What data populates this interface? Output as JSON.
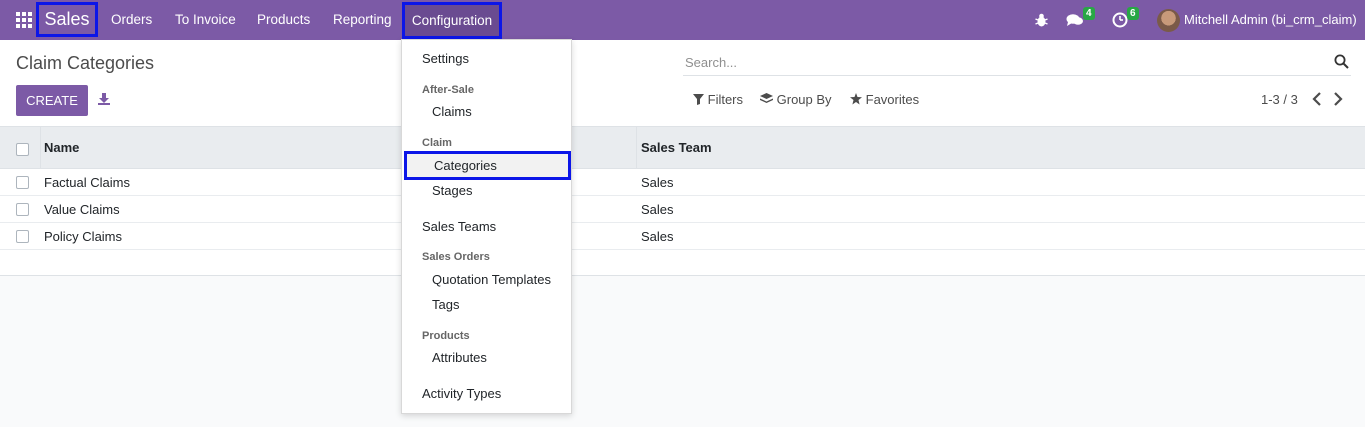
{
  "navbar": {
    "app_name": "Sales",
    "menu": [
      "Orders",
      "To Invoice",
      "Products",
      "Reporting"
    ],
    "active_menu": "Configuration",
    "messages_count": "4",
    "activities_count": "6",
    "user_name": "Mitchell Admin (bi_crm_claim)",
    "colors": {
      "navbar": "#7c5aa6",
      "highlight_border": "#0c16e8",
      "badge": "#28a745"
    }
  },
  "control_panel": {
    "title": "Claim Categories",
    "create_label": "CREATE",
    "search_placeholder": "Search...",
    "filters_label": "Filters",
    "group_by_label": "Group By",
    "favorites_label": "Favorites",
    "pager": "1-3 / 3"
  },
  "table": {
    "columns": [
      "Name",
      "Sales Team"
    ],
    "rows": [
      {
        "name": "Factual Claims",
        "team": "Sales"
      },
      {
        "name": "Value Claims",
        "team": "Sales"
      },
      {
        "name": "Policy Claims",
        "team": "Sales"
      }
    ]
  },
  "dropdown": {
    "settings": "Settings",
    "after_sale_header": "After-Sale",
    "claims": "Claims",
    "claim_header": "Claim",
    "categories": "Categories",
    "stages": "Stages",
    "sales_teams": "Sales Teams",
    "sales_orders_header": "Sales Orders",
    "quotation_templates": "Quotation Templates",
    "tags": "Tags",
    "products_header": "Products",
    "attributes": "Attributes",
    "activity_types": "Activity Types"
  }
}
